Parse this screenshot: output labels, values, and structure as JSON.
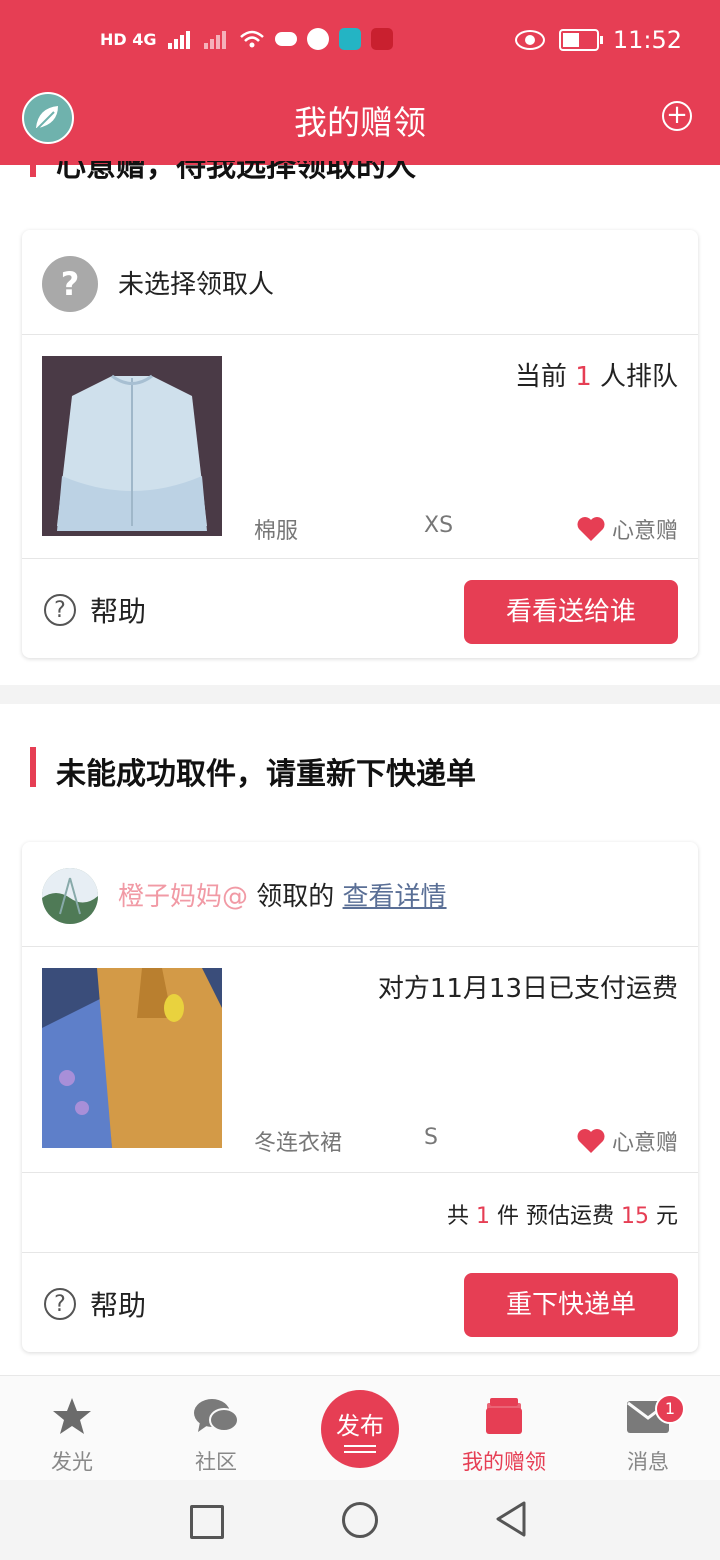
{
  "status_bar": {
    "left": "HD 4G",
    "time": "11:52"
  },
  "header": {
    "title": "我的赠领",
    "add_icon": "plus-circle-icon"
  },
  "section1": {
    "title_cut": "心意赠，待我选择领取的人",
    "card": {
      "recipient": "未选择领取人",
      "queue_prefix": "当前 ",
      "queue_count": "1",
      "queue_suffix": " 人排队",
      "item_name": "棉服",
      "size": "XS",
      "tag": "心意赠",
      "help": "帮助",
      "action": "看看送给谁"
    }
  },
  "section2": {
    "title": "未能成功取件，请重新下快递单",
    "card": {
      "user": "橙子妈妈@",
      "claimed": " 领取的 ",
      "details_link": "查看详情",
      "status": "对方11月13日已支付运费",
      "item_name": "冬连衣裙",
      "size": "S",
      "tag": "心意赠",
      "summary_a": "共 ",
      "count": "1",
      "summary_b": " 件 预估运费 ",
      "fee": "15",
      "summary_c": " 元",
      "help": "帮助",
      "action": "重下快递单"
    }
  },
  "bottom_nav": {
    "items": [
      {
        "label": "发光",
        "icon": "star-icon"
      },
      {
        "label": "社区",
        "icon": "chat-bubbles-icon"
      },
      {
        "label": "发布",
        "icon": "publish-icon"
      },
      {
        "label": "我的赠领",
        "icon": "wallet-cards-icon"
      },
      {
        "label": "消息",
        "icon": "mail-icon"
      }
    ],
    "message_badge": "1",
    "active_color": "#e63e54"
  },
  "colors": {
    "brand": "#e63e54",
    "username": "#f19aa5"
  }
}
